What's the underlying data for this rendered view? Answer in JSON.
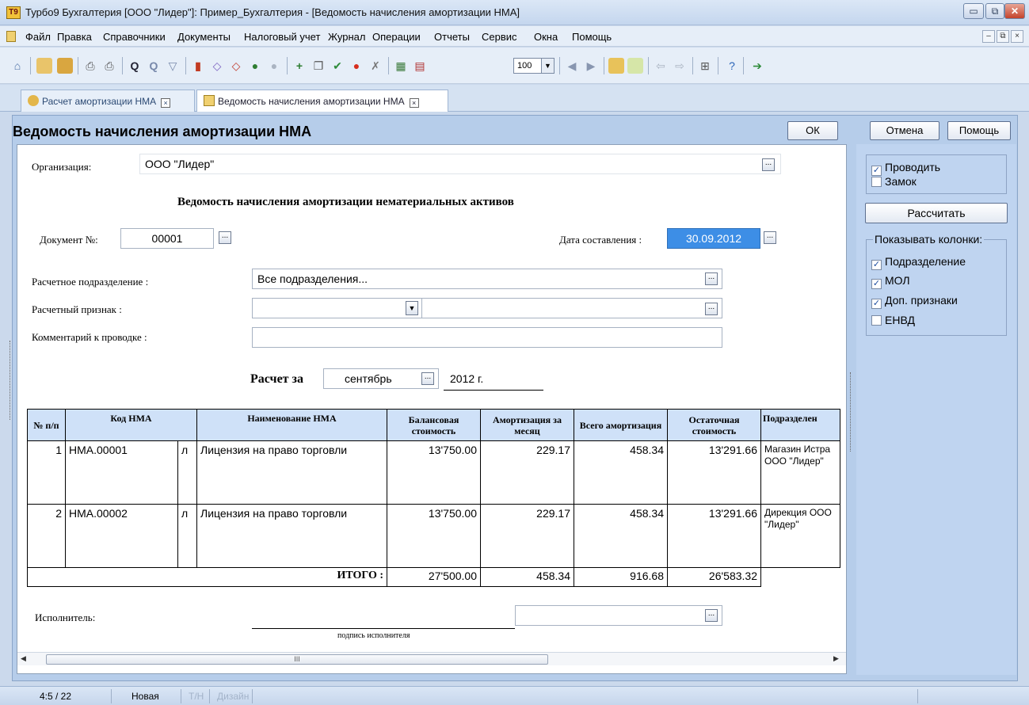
{
  "window": {
    "title": "Турбо9 Бухгалтерия [ООО \"Лидер\"]: Пример_Бухгалтерия - [Ведомость начисления амортизации НМА]",
    "app_icon": "Т9",
    "controls": {
      "minimize": "▭",
      "maximize": "⧉",
      "close": "✕"
    }
  },
  "menu": {
    "items": [
      "Файл",
      "Правка",
      "Справочники",
      "Документы",
      "Налоговый учет",
      "Журнал",
      "Операции",
      "Отчеты",
      "Сервис",
      "Окна",
      "Помощь"
    ],
    "mdi": {
      "minimize": "–",
      "restore": "⧉",
      "close": "×"
    }
  },
  "toolbar": {
    "zoom_value": "100",
    "icons": [
      "home-icon",
      "copy-icon",
      "paste-icon",
      "print-icon",
      "print-preview-icon",
      "search-icon",
      "find-next-icon",
      "filter-icon",
      "chart-icon",
      "tag-icon",
      "tag-remove-icon",
      "attach-icon",
      "disabled-icon",
      "add-icon",
      "copy-doc-icon",
      "check-icon",
      "stop-icon",
      "delete-icon",
      "calculator-icon",
      "calendar-icon",
      "zoom-select-icon",
      "nav-back-icon",
      "nav-forward-icon",
      "folder-icon",
      "note-icon",
      "arrow-left-icon",
      "arrow-right-icon",
      "structure-icon",
      "help-icon",
      "exit-icon"
    ]
  },
  "tabs": [
    {
      "label": "Расчет амортизации НМА",
      "close": "×",
      "active": false
    },
    {
      "label": "Ведомость начисления амортизации НМА",
      "close": "×",
      "active": true
    }
  ],
  "document": {
    "title": "Ведомость начисления амортизации НМА",
    "buttons": {
      "ok": "ОК",
      "cancel": "Отмена",
      "help": "Помощь"
    }
  },
  "form": {
    "organization_label": "Организация:",
    "organization_value": "ООО \"Лидер\"",
    "heading": "Ведомость начисления амортизации нематериальных активов",
    "doc_number_label": "Документ №:",
    "doc_number_value": "00001",
    "date_label": "Дата составления :",
    "date_value": "30.09.2012",
    "department_label": "Расчетное подразделение :",
    "department_value": "Все подразделения...",
    "sign_label": "Расчетный признак :",
    "sign_value": "",
    "comment_label": "Комментарий к проводке :",
    "comment_value": "",
    "period_label": "Расчет за",
    "period_month": "сентябрь",
    "period_year": "2012 г.",
    "executor_label": "Исполнитель:",
    "executor_value": "",
    "signature_caption": "подпись исполнителя",
    "ellipsis": "..."
  },
  "table": {
    "headers": {
      "num": "№ п/п",
      "code": "Код НМА",
      "name": "Наименование НМА",
      "balance": "Балансовая стоимость",
      "monthly": "Амортизация за месяц",
      "total": "Всего амортизация",
      "residual": "Остаточная стоимость",
      "department": "Подразделен"
    },
    "rows": [
      {
        "num": "1",
        "code": "НМА.00001",
        "flag": "л",
        "name": "Лицензия на право торговли",
        "balance": "13'750.00",
        "monthly": "229.17",
        "total": "458.34",
        "residual": "13'291.66",
        "department": "Магазин Истра ООО \"Лидер\""
      },
      {
        "num": "2",
        "code": "НМА.00002",
        "flag": "л",
        "name": "Лицензия на право торговли",
        "balance": "13'750.00",
        "monthly": "229.17",
        "total": "458.34",
        "residual": "13'291.66",
        "department": "Дирекция ООО \"Лидер\""
      }
    ],
    "totals": {
      "label": "ИТОГО :",
      "balance": "27'500.00",
      "monthly": "458.34",
      "total": "916.68",
      "residual": "26'583.32"
    }
  },
  "scrollbar": {
    "left_arrow": "◀",
    "right_arrow": "▶",
    "grip": "III"
  },
  "right_panel": {
    "checkboxes_top": [
      {
        "label": "Проводить",
        "checked": true
      },
      {
        "label": "Замок",
        "checked": false
      }
    ],
    "calc_button": "Рассчитать",
    "columns_group_title": "Показывать колонки:",
    "columns": [
      {
        "label": "Подразделение",
        "checked": true
      },
      {
        "label": "МОЛ",
        "checked": true
      },
      {
        "label": "Доп. признаки",
        "checked": true
      },
      {
        "label": "ЕНВД",
        "checked": false
      }
    ],
    "check_mark": "✓"
  },
  "status": {
    "position": "4:5 / 22",
    "state": "Новая",
    "mode1": "Т/Н",
    "mode2": "Дизайн"
  },
  "colors": {
    "accent_date": "#3d8ee6",
    "header_cell": "#cfe1f8",
    "panel": "#bfd4f0"
  }
}
